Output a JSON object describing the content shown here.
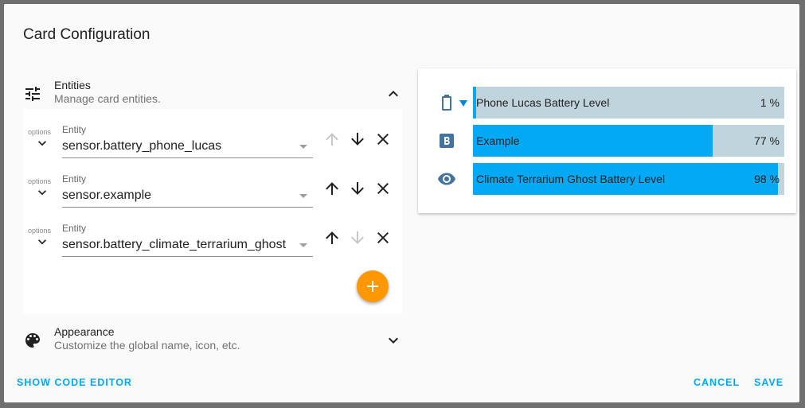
{
  "dialog": {
    "title": "Card Configuration",
    "show_code_editor": "SHOW CODE EDITOR",
    "cancel": "CANCEL",
    "save": "SAVE"
  },
  "entities_section": {
    "title": "Entities",
    "subtitle": "Manage card entities.",
    "icon": "tune-icon",
    "rows": [
      {
        "options_label": "options",
        "field_label": "Entity",
        "value": "sensor.battery_phone_lucas",
        "up_enabled": false,
        "down_enabled": true
      },
      {
        "options_label": "options",
        "field_label": "Entity",
        "value": "sensor.example",
        "up_enabled": true,
        "down_enabled": true
      },
      {
        "options_label": "options",
        "field_label": "Entity",
        "value": "sensor.battery_climate_terrarium_ghost",
        "up_enabled": true,
        "down_enabled": false
      }
    ]
  },
  "appearance_section": {
    "title": "Appearance",
    "subtitle": "Customize the global name, icon, etc.",
    "icon": "palette-icon"
  },
  "preview": {
    "bars": [
      {
        "name": "Phone Lucas Battery Level",
        "value_label": "1 %",
        "percent": 1,
        "icon": "battery-outline-icon"
      },
      {
        "name": "Example",
        "value_label": "77 %",
        "percent": 77,
        "icon": "b-badge-icon"
      },
      {
        "name": "Climate Terrarium Ghost Battery Level",
        "value_label": "98 %",
        "percent": 98,
        "icon": "eye-icon"
      }
    ]
  },
  "colors": {
    "accent": "#03a9f4",
    "fab": "#ff9800",
    "bar_track": "#c0d4dd",
    "icon_blue": "#44739e"
  }
}
